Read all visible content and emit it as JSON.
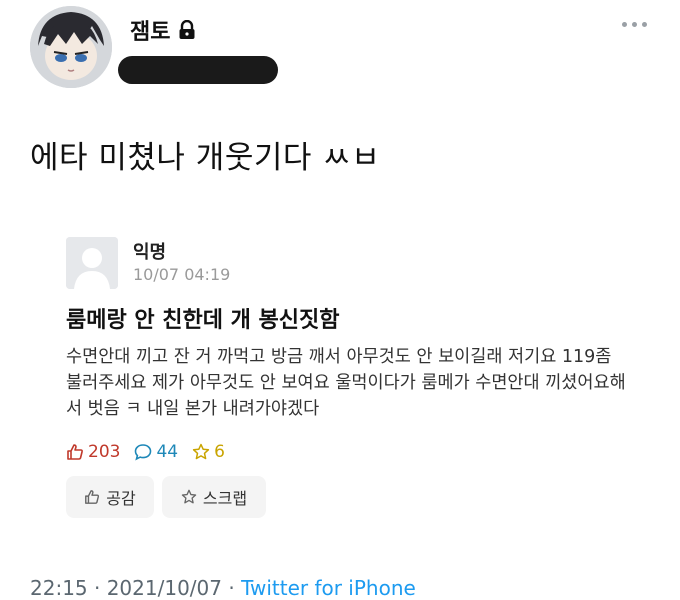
{
  "tweet": {
    "display_name": "잼토",
    "text": "에타 미쳤나 개웃기다 ㅆㅂ",
    "timestamp": "22:15 · 2021/10/07 · ",
    "source": "Twitter for iPhone"
  },
  "post": {
    "author": "익명",
    "time": "10/07 04:19",
    "title": "룸메랑 안 친한데 개 봉신짓함",
    "body": "수면안대 끼고 잔 거 까먹고 방금 깨서 아무것도 안 보이길래 저기요 119좀 불러주세요 제가 아무것도 안 보여요 울먹이다가 룸메가 수면안대 끼셨어요해서 벗음 ㅋ 내일 본가 내려가야겠다",
    "likes": "203",
    "comments": "44",
    "scraps": "6",
    "like_button": "공감",
    "scrap_button": "스크랩"
  },
  "colors": {
    "link": "#1d9bf0",
    "like": "#c0392b",
    "comment": "#1e88b8",
    "scrap": "#c9a400"
  }
}
